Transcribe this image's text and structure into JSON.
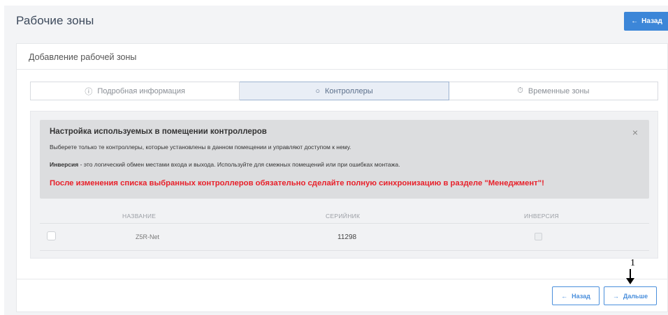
{
  "page": {
    "title": "Рабочие зоны",
    "back_button": "Назад",
    "back_icon": "←"
  },
  "card": {
    "title": "Добавление рабочей зоны"
  },
  "tabs": [
    {
      "label": "Подробная информация",
      "icon": "info-circle-icon",
      "glyph": "ⓘ",
      "active": false
    },
    {
      "label": "Контроллеры",
      "icon": "controller-icon",
      "glyph": "○",
      "active": true
    },
    {
      "label": "Временные зоны",
      "icon": "timer-icon",
      "glyph": "⏱",
      "active": false
    }
  ],
  "alert": {
    "title": "Настройка используемых в помещении контроллеров",
    "close": "×",
    "line1": "Выберете только те контроллеры, которые установлены в данном помещении и управляют доступом к нему.",
    "line2_bold": "Инверсия",
    "line2_rest": " - это логический обмен местами входа и выхода. Используйте для смежных помещений или при ошибках монтажа.",
    "warning": "После изменения списка выбранных контроллеров обязательно сделайте полную синхронизацию в разделе \"Менеджмент\"!",
    "warning_color": "#e8202a"
  },
  "table": {
    "columns": [
      "НАЗВАНИЕ",
      "СЕРИЙНИК",
      "ИНВЕРСИЯ"
    ],
    "rows": [
      {
        "selected": false,
        "name": "Z5R-Net",
        "serial": "11298",
        "inversion": false
      }
    ]
  },
  "footer": {
    "back_label": "Назад",
    "back_icon": "←",
    "next_label": "Дальше",
    "next_icon": "→"
  },
  "annotation": {
    "number": "1"
  },
  "colors": {
    "accent": "#3c86d8",
    "outline": "#4a8fdc"
  }
}
